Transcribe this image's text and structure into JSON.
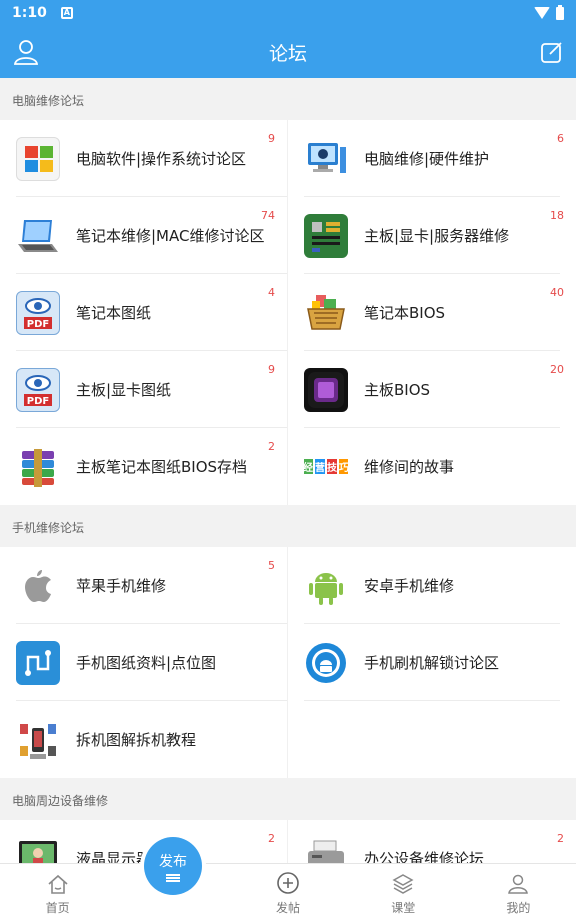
{
  "status_bar": {
    "time": "1:10",
    "notif": "A"
  },
  "app_bar": {
    "title": "论坛"
  },
  "sections": [
    {
      "title": "电脑维修论坛",
      "items": [
        {
          "label": "电脑软件|操作系统讨论区",
          "badge": "9",
          "icon": "windows-icon"
        },
        {
          "label": "电脑维修|硬件维护",
          "badge": "6",
          "icon": "computer-repair-icon"
        },
        {
          "label": "笔记本维修|MAC维修讨论区",
          "badge": "74",
          "icon": "laptop-icon"
        },
        {
          "label": "主板|显卡|服务器维修",
          "badge": "18",
          "icon": "motherboard-icon"
        },
        {
          "label": "笔记本图纸",
          "badge": "4",
          "icon": "pdf-icon"
        },
        {
          "label": "笔记本BIOS",
          "badge": "40",
          "icon": "basket-icon"
        },
        {
          "label": "主板|显卡图纸",
          "badge": "9",
          "icon": "pdf-icon"
        },
        {
          "label": "主板BIOS",
          "badge": "20",
          "icon": "chip-icon"
        },
        {
          "label": "主板笔记本图纸BIOS存档",
          "badge": "2",
          "icon": "archive-icon"
        },
        {
          "label": "维修间的故事",
          "badge": "",
          "icon": "tips-icon"
        }
      ]
    },
    {
      "title": "手机维修论坛",
      "items": [
        {
          "label": "苹果手机维修",
          "badge": "5",
          "icon": "apple-icon"
        },
        {
          "label": "安卓手机维修",
          "badge": "",
          "icon": "android-icon"
        },
        {
          "label": "手机图纸资料|点位图",
          "badge": "",
          "icon": "schematic-icon"
        },
        {
          "label": "手机刷机解锁讨论区",
          "badge": "",
          "icon": "flash-unlock-icon"
        },
        {
          "label": "拆机图解拆机教程",
          "badge": "",
          "icon": "teardown-icon"
        }
      ]
    },
    {
      "title": "电脑周边设备维修",
      "items": [
        {
          "label": "液晶显示器维修",
          "badge": "2",
          "icon": "monitor-icon"
        },
        {
          "label": "办公设备维修论坛",
          "badge": "2",
          "icon": "printer-icon"
        }
      ]
    }
  ],
  "tips_icon": {
    "chars": [
      "经",
      "营",
      "技",
      "巧"
    ]
  },
  "bottom_nav": {
    "home": "首页",
    "publish": "发布",
    "post": "发帖",
    "class": "课堂",
    "mine": "我的"
  },
  "colors": {
    "primary": "#3aa0ec",
    "badge": "#e54b4b"
  }
}
